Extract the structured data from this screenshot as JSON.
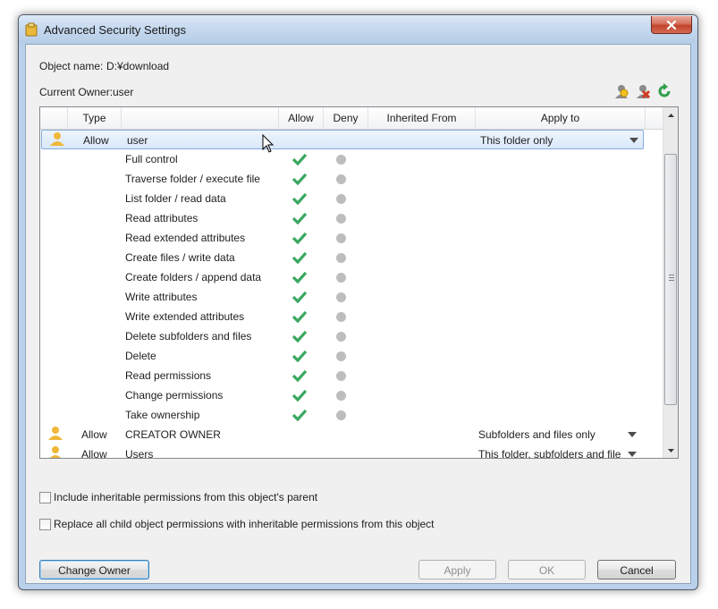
{
  "window": {
    "title": "Advanced Security Settings"
  },
  "object": {
    "name_label": "Object name:",
    "name_value": "D:¥download"
  },
  "owner": {
    "label": "Current Owner:",
    "value": "user"
  },
  "toolbar": {
    "icons": [
      "add-user-icon",
      "remove-user-icon",
      "refresh-icon"
    ]
  },
  "table": {
    "columns": [
      "Type",
      "Allow",
      "Deny",
      "Inherited From",
      "Apply to"
    ],
    "rows": [
      {
        "kind": "principal",
        "type": "Allow",
        "name": "user",
        "apply_to": "This folder only",
        "selected": true
      },
      {
        "kind": "perm",
        "name": "Full control",
        "allow": true,
        "deny": false
      },
      {
        "kind": "perm",
        "name": "Traverse folder / execute file",
        "allow": true,
        "deny": false
      },
      {
        "kind": "perm",
        "name": "List folder / read data",
        "allow": true,
        "deny": false
      },
      {
        "kind": "perm",
        "name": "Read attributes",
        "allow": true,
        "deny": false
      },
      {
        "kind": "perm",
        "name": "Read extended attributes",
        "allow": true,
        "deny": false
      },
      {
        "kind": "perm",
        "name": "Create files / write data",
        "allow": true,
        "deny": false
      },
      {
        "kind": "perm",
        "name": "Create folders / append data",
        "allow": true,
        "deny": false
      },
      {
        "kind": "perm",
        "name": "Write attributes",
        "allow": true,
        "deny": false
      },
      {
        "kind": "perm",
        "name": "Write extended attributes",
        "allow": true,
        "deny": false
      },
      {
        "kind": "perm",
        "name": "Delete subfolders and files",
        "allow": true,
        "deny": false
      },
      {
        "kind": "perm",
        "name": "Delete",
        "allow": true,
        "deny": false
      },
      {
        "kind": "perm",
        "name": "Read permissions",
        "allow": true,
        "deny": false
      },
      {
        "kind": "perm",
        "name": "Change permissions",
        "allow": true,
        "deny": false
      },
      {
        "kind": "perm",
        "name": "Take ownership",
        "allow": true,
        "deny": false
      },
      {
        "kind": "principal",
        "type": "Allow",
        "name": "CREATOR OWNER",
        "apply_to": "Subfolders and files only",
        "selected": false
      },
      {
        "kind": "principal",
        "type": "Allow",
        "name": "Users",
        "apply_to": "This folder, subfolders and files",
        "selected": false
      }
    ]
  },
  "options": {
    "inherit_label": "Include inheritable permissions from this object's parent",
    "replace_label": "Replace all child object permissions with inheritable permissions from this object"
  },
  "buttons": {
    "change_owner": "Change Owner",
    "apply": "Apply",
    "ok": "OK",
    "cancel": "Cancel"
  },
  "colors": {
    "check": "#3aa860",
    "deny_dot": "#bdbdbd",
    "selection": "#d9e8f9",
    "user_icon": "#f0b73a"
  }
}
